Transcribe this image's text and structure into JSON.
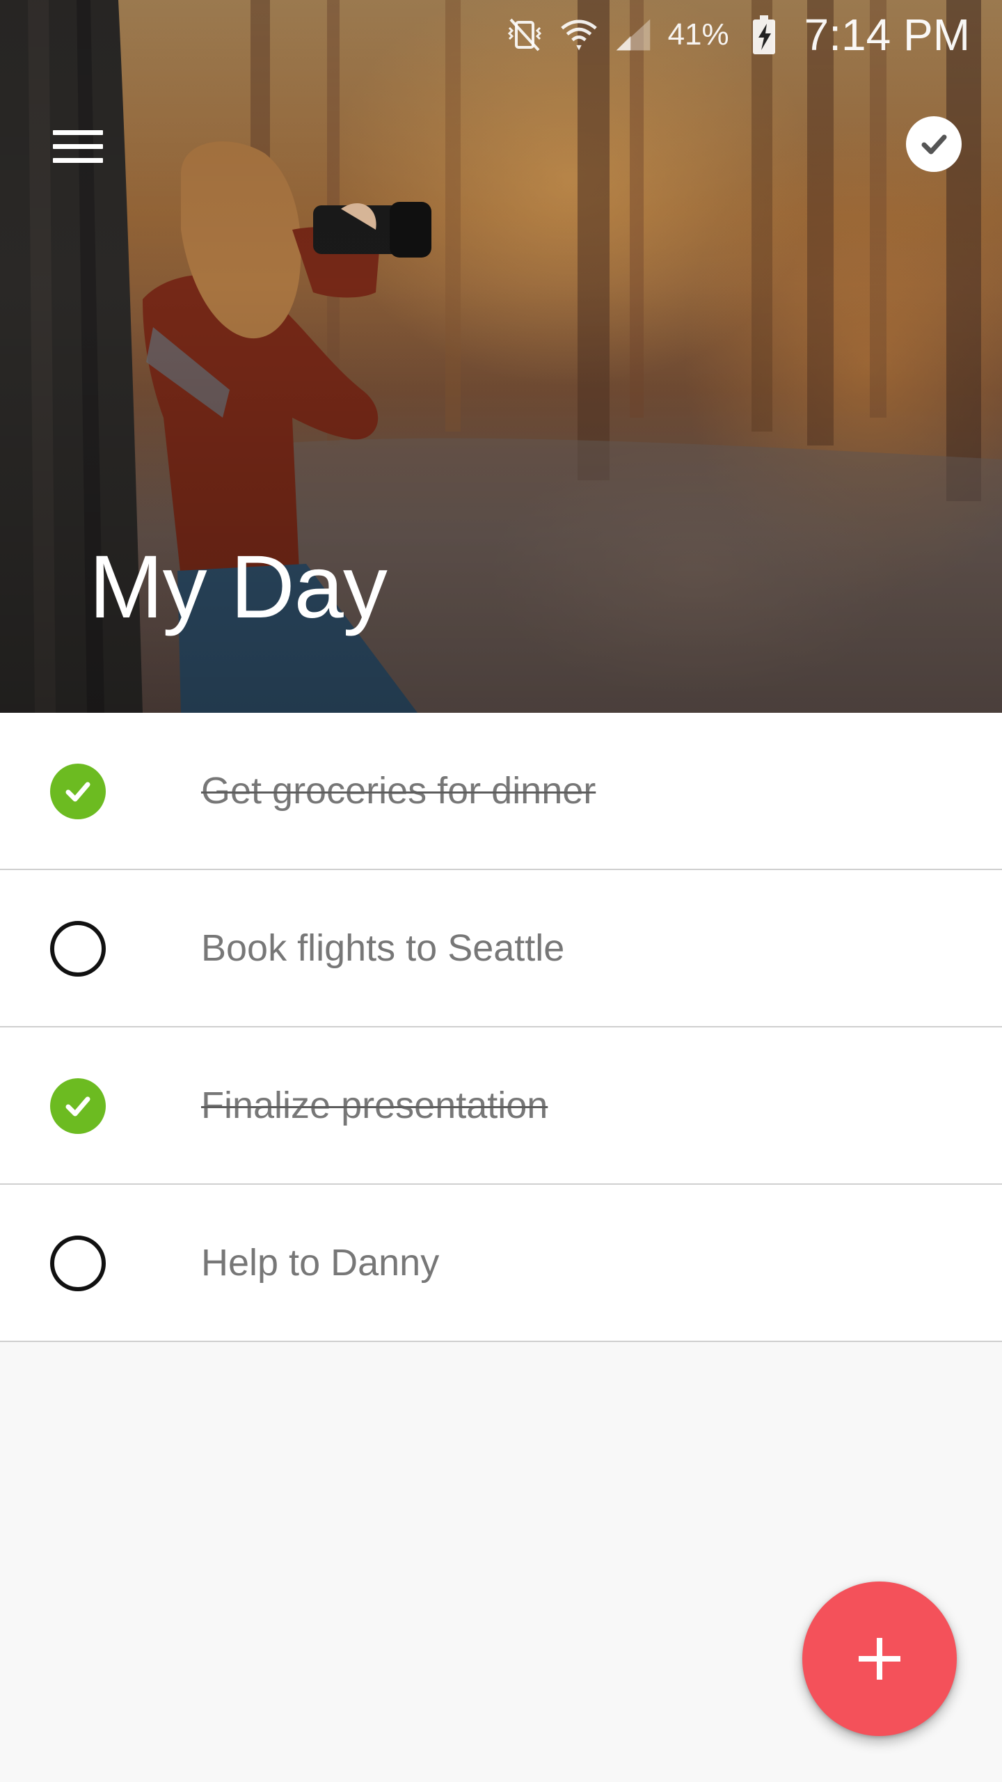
{
  "status_bar": {
    "battery_percent": "41%",
    "time": "7:14 PM",
    "icons": [
      "vibrate-off-icon",
      "wifi-icon",
      "cellular-signal-icon",
      "battery-charging-icon"
    ]
  },
  "toolbar": {
    "menu_icon": "hamburger-menu-icon",
    "action_icon": "check-circle-icon"
  },
  "header": {
    "title": "My Day"
  },
  "tasks": [
    {
      "label": "Get groceries for dinner",
      "completed": true
    },
    {
      "label": "Book flights to Seattle",
      "completed": false
    },
    {
      "label": "Finalize presentation",
      "completed": true
    },
    {
      "label": "Help to Danny",
      "completed": false
    }
  ],
  "fab": {
    "icon": "plus-icon"
  },
  "colors": {
    "completed_check": "#6cbb21",
    "fab": "#f4515a",
    "task_text": "#777777",
    "background": "#f8f8f8"
  }
}
